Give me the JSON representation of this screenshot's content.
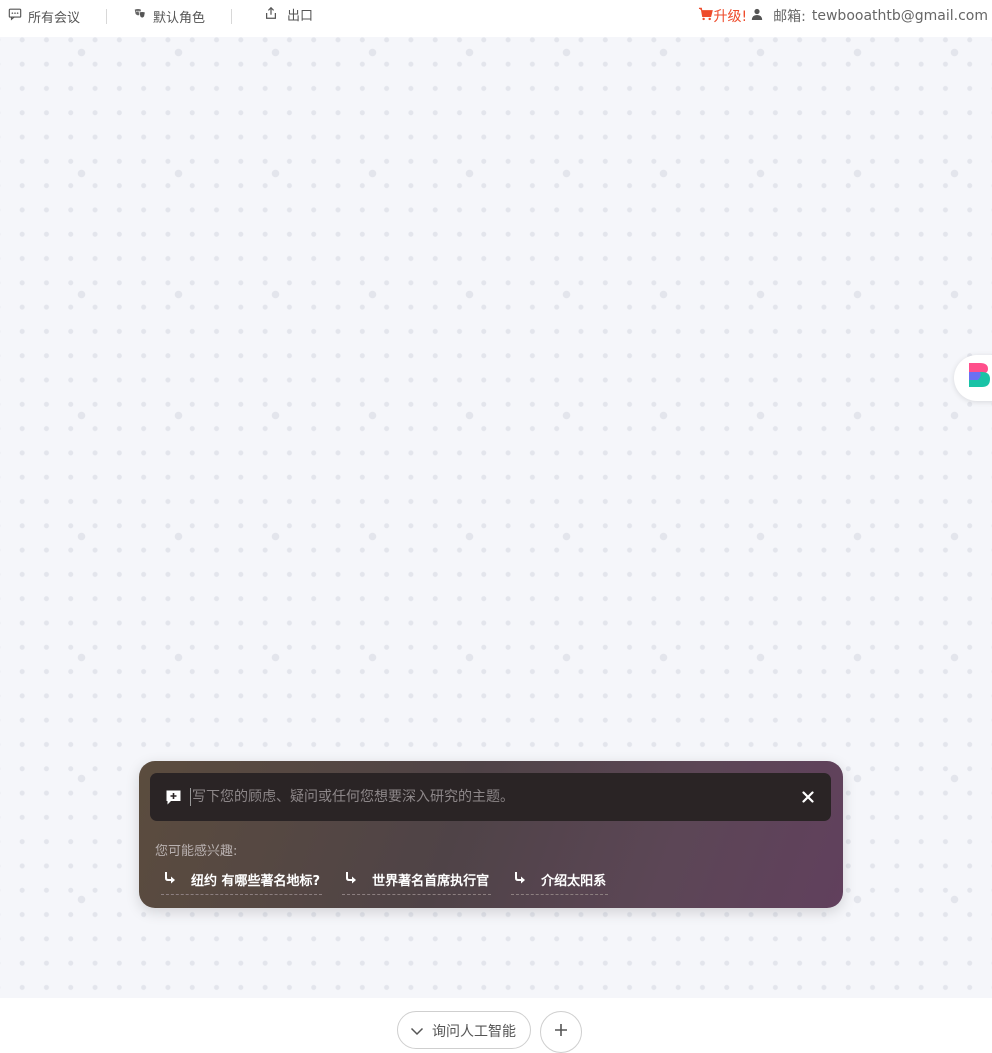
{
  "topbar": {
    "all_meetings": "所有会议",
    "default_role": "默认角色",
    "export": "出口",
    "upgrade": "升级!",
    "email_label": "邮箱:",
    "email": "tewbooathtb@gmail.com"
  },
  "prompt": {
    "placeholder": "写下您的顾虑、疑问或任何您想要深入研究的主题。",
    "value": ""
  },
  "suggestions": {
    "title": "您可能感兴趣:",
    "items": [
      {
        "label": "纽约 有哪些著名地标?"
      },
      {
        "label": "世界著名首席执行官"
      },
      {
        "label": "介绍太阳系"
      }
    ]
  },
  "bottom": {
    "ask_ai": "询问人工智能"
  },
  "colors": {
    "accent": "#ee4b2b",
    "canvas_bg": "#f5f6fa",
    "panel_from": "#5b4c3e",
    "panel_to": "#61405d",
    "prompt_bg": "#2a2425"
  },
  "icons": {
    "all_meetings": "chat-bubble-icon",
    "default_role": "theater-masks-icon",
    "export": "share-upload-icon",
    "upgrade": "cart-icon",
    "user": "user-icon",
    "prompt": "chat-plus-icon",
    "close": "close-icon",
    "suggestion": "arrow-turn-icon",
    "ask_ai": "chevron-down-icon",
    "add": "plus-icon"
  }
}
